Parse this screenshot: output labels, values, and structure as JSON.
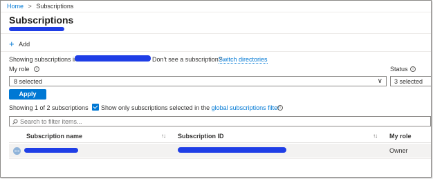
{
  "breadcrumb": {
    "home": "Home",
    "separator": ">",
    "current": "Subscriptions"
  },
  "page": {
    "title": "Subscriptions"
  },
  "toolbar": {
    "add_icon": "+",
    "add_label": "Add"
  },
  "directory": {
    "showing_prefix": "Showing subscriptions in",
    "dont_see": "Don't see a subscription?",
    "switch_link": "Switch directories"
  },
  "filters": {
    "my_role_label": "My role",
    "my_role_value": "8 selected",
    "status_label": "Status",
    "status_value": "3 selected",
    "info_glyph": "i",
    "chevron": "∨"
  },
  "apply_label": "Apply",
  "count_text": "Showing 1 of 2 subscriptions",
  "show_only": {
    "prefix": "Show only subscriptions selected in the",
    "link": "global subscriptions filter"
  },
  "search": {
    "placeholder": "Search to filter items..."
  },
  "table": {
    "columns": [
      "Subscription name",
      "Subscription ID",
      "My role"
    ],
    "sort_glyph": "↑↓",
    "rows": [
      {
        "role": "Owner"
      }
    ]
  },
  "colors": {
    "accent": "#0078d4",
    "redaction": "#1f3ee6",
    "row_bg": "#f3f2f1"
  }
}
